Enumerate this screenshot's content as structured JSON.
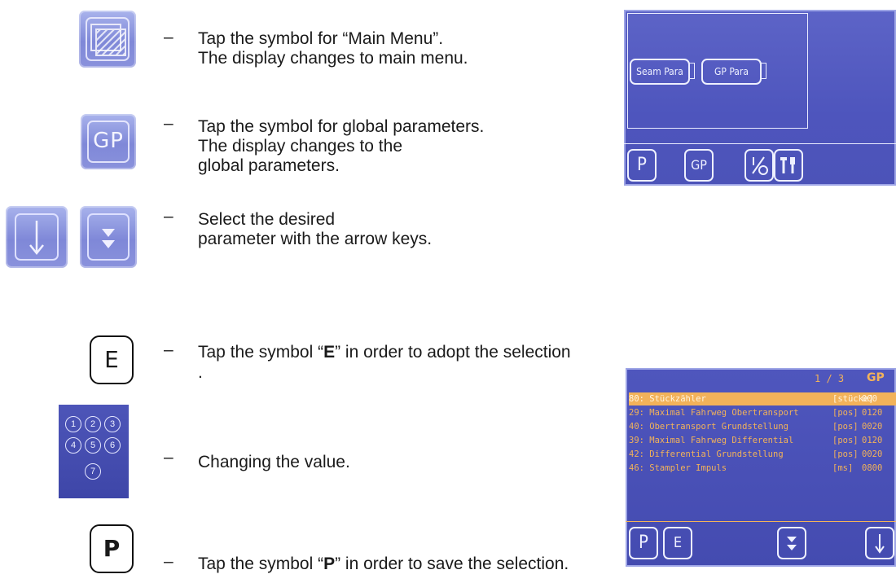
{
  "steps": [
    {
      "dash": "–",
      "lines": [
        "Tap the symbol for “Main Menu”.",
        "The display changes to main menu."
      ]
    },
    {
      "dash": "–",
      "lines": [
        "Tap the symbol for global parameters.",
        "The display changes to the",
        "global parameters."
      ]
    },
    {
      "dash": "–",
      "lines": [
        "Select the desired",
        "parameter with the arrow keys."
      ]
    },
    {
      "dash": "–",
      "pre": "Tap the symbol “",
      "bold": "E",
      "post": "” in order to adopt the selection",
      "line2": "."
    },
    {
      "dash": "–",
      "lines": [
        "Changing the value."
      ]
    },
    {
      "dash": "–",
      "pre": "Tap the symbol “",
      "bold": "P",
      "post": "” in order to save the selection."
    }
  ],
  "icons": {
    "gp": "GP",
    "e_key": "E",
    "p_key": "P",
    "arrow_down": "↓",
    "page_down": "⩡",
    "keypad": [
      "1",
      "2",
      "3",
      "4",
      "5",
      "6",
      "7"
    ]
  },
  "screen_main_menu": {
    "buttons": [
      "Seam Para",
      "GP Para"
    ],
    "footer": [
      "P",
      "GP",
      "I/O",
      "Service"
    ]
  },
  "screen_gp": {
    "page": "1 / 3",
    "title": "GP",
    "rows": [
      {
        "name": "80: Stückzähler",
        "unit": "[stücke]",
        "value": "000"
      },
      {
        "name": "29: Maximal Fahrweg Obertransport",
        "unit": "[pos]",
        "value": "0120"
      },
      {
        "name": "40: Obertransport Grundstellung",
        "unit": "[pos]",
        "value": "0020"
      },
      {
        "name": "39: Maximal Fahrweg Differential",
        "unit": "[pos]",
        "value": "0120"
      },
      {
        "name": "42: Differential Grundstellung",
        "unit": "[pos]",
        "value": "0020"
      },
      {
        "name": "46: Stampler Impuls",
        "unit": "[ms]",
        "value": "0800"
      }
    ],
    "footer": [
      "P",
      "E",
      "⩡",
      "↓"
    ]
  },
  "colors": {
    "lcd_blue": "#5058bd",
    "highlight": "#f2b25a",
    "icon_blue": "#8f98e0"
  }
}
